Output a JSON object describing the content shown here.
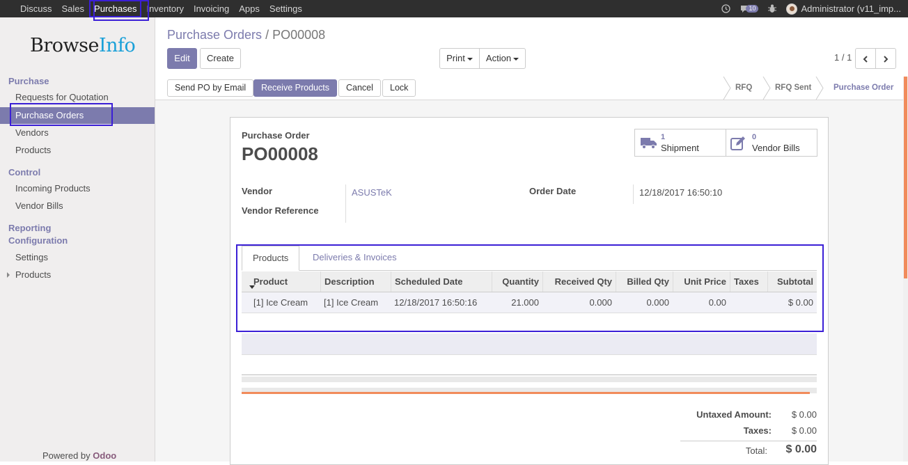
{
  "topbar": {
    "menu": [
      "Discuss",
      "Sales",
      "Purchases",
      "Inventory",
      "Invoicing",
      "Apps",
      "Settings"
    ],
    "active_menu": "Purchases",
    "messages_count": "10",
    "user": "Administrator (v11_imp..."
  },
  "sidebar": {
    "logo_part1": "Browse",
    "logo_part2": "Info",
    "sections": [
      {
        "title": "Purchase",
        "items": [
          "Requests for Quotation",
          "Purchase Orders",
          "Vendors",
          "Products"
        ]
      },
      {
        "title": "Control",
        "items": [
          "Incoming Products",
          "Vendor Bills"
        ]
      },
      {
        "title": "Reporting",
        "items": []
      },
      {
        "title": "Configuration",
        "items": [
          "Settings",
          "Products"
        ]
      }
    ],
    "active_item": "Purchase Orders",
    "powered_by": "Powered by",
    "powered_brand": "Odoo"
  },
  "control_panel": {
    "breadcrumb_parent": "Purchase Orders",
    "breadcrumb_sep": "/",
    "breadcrumb_current": "PO00008",
    "edit_label": "Edit",
    "create_label": "Create",
    "print_label": "Print",
    "action_label": "Action",
    "pager": "1 / 1"
  },
  "statusbar": {
    "buttons": [
      "Send PO by Email",
      "Receive Products",
      "Cancel",
      "Lock"
    ],
    "stages": [
      "RFQ",
      "RFQ Sent",
      "Purchase Order"
    ],
    "active_stage": "Purchase Order"
  },
  "form": {
    "doc_type": "Purchase Order",
    "doc_name": "PO00008",
    "smart_buttons": [
      {
        "count": "1",
        "label": "Shipment",
        "icon": "truck-icon"
      },
      {
        "count": "0",
        "label": "Vendor Bills",
        "icon": "pencil-square-icon"
      }
    ],
    "vendor_label": "Vendor",
    "vendor_value": "ASUSTeK",
    "vendor_ref_label": "Vendor Reference",
    "order_date_label": "Order Date",
    "order_date_value": "12/18/2017 16:50:10",
    "tabs": [
      "Products",
      "Deliveries & Invoices"
    ],
    "active_tab": "Products",
    "columns": [
      "Product",
      "Description",
      "Scheduled Date",
      "Quantity",
      "Received Qty",
      "Billed Qty",
      "Unit Price",
      "Taxes",
      "Subtotal"
    ],
    "rows": [
      [
        "[1] Ice Cream",
        "[1] Ice Cream",
        "12/18/2017 16:50:16",
        "21.000",
        "0.000",
        "0.000",
        "0.00",
        "",
        "$ 0.00"
      ]
    ],
    "totals": {
      "untaxed_label": "Untaxed Amount:",
      "untaxed_value": "$ 0.00",
      "taxes_label": "Taxes:",
      "taxes_value": "$ 0.00",
      "total_label": "Total:",
      "total_value": "$ 0.00"
    }
  },
  "colors": {
    "accent": "#7c7bad",
    "highlight_box": "#3b1fd6",
    "navbar": "#2f2f2f"
  }
}
